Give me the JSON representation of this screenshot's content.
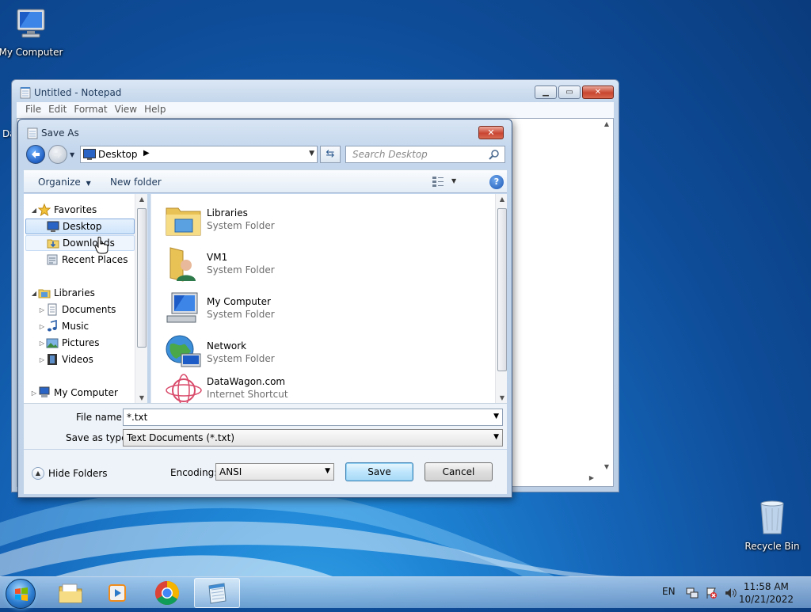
{
  "desktop": {
    "icons": [
      {
        "name": "my-computer",
        "label": "My Computer"
      },
      {
        "name": "recycle-bin",
        "label": "Recycle Bin"
      }
    ],
    "partial_left_label": "Da"
  },
  "notepad": {
    "title": "Untitled - Notepad",
    "menu": [
      "File",
      "Edit",
      "Format",
      "View",
      "Help"
    ]
  },
  "save_as": {
    "title": "Save As",
    "address": "Desktop",
    "search_placeholder": "Search Desktop",
    "toolbar": {
      "organize": "Organize",
      "new_folder": "New folder"
    },
    "nav": {
      "favorites": "Favorites",
      "desktop": "Desktop",
      "downloads": "Downloads",
      "recent_places": "Recent Places",
      "libraries": "Libraries",
      "documents": "Documents",
      "music": "Music",
      "pictures": "Pictures",
      "videos": "Videos",
      "my_computer": "My Computer"
    },
    "files": [
      {
        "name": "Libraries",
        "type": "System Folder"
      },
      {
        "name": "VM1",
        "type": "System Folder"
      },
      {
        "name": "My Computer",
        "type": "System Folder"
      },
      {
        "name": "Network",
        "type": "System Folder"
      },
      {
        "name": "DataWagon.com",
        "type": "Internet Shortcut"
      }
    ],
    "file_name_label": "File name:",
    "file_name_value": "*.txt",
    "save_as_type_label": "Save as type:",
    "save_as_type_value": "Text Documents (*.txt)",
    "hide_folders": "Hide Folders",
    "encoding_label": "Encoding:",
    "encoding_value": "ANSI",
    "save_button": "Save",
    "cancel_button": "Cancel"
  },
  "taskbar": {
    "language": "EN",
    "time": "11:58 AM",
    "date": "10/21/2022"
  }
}
